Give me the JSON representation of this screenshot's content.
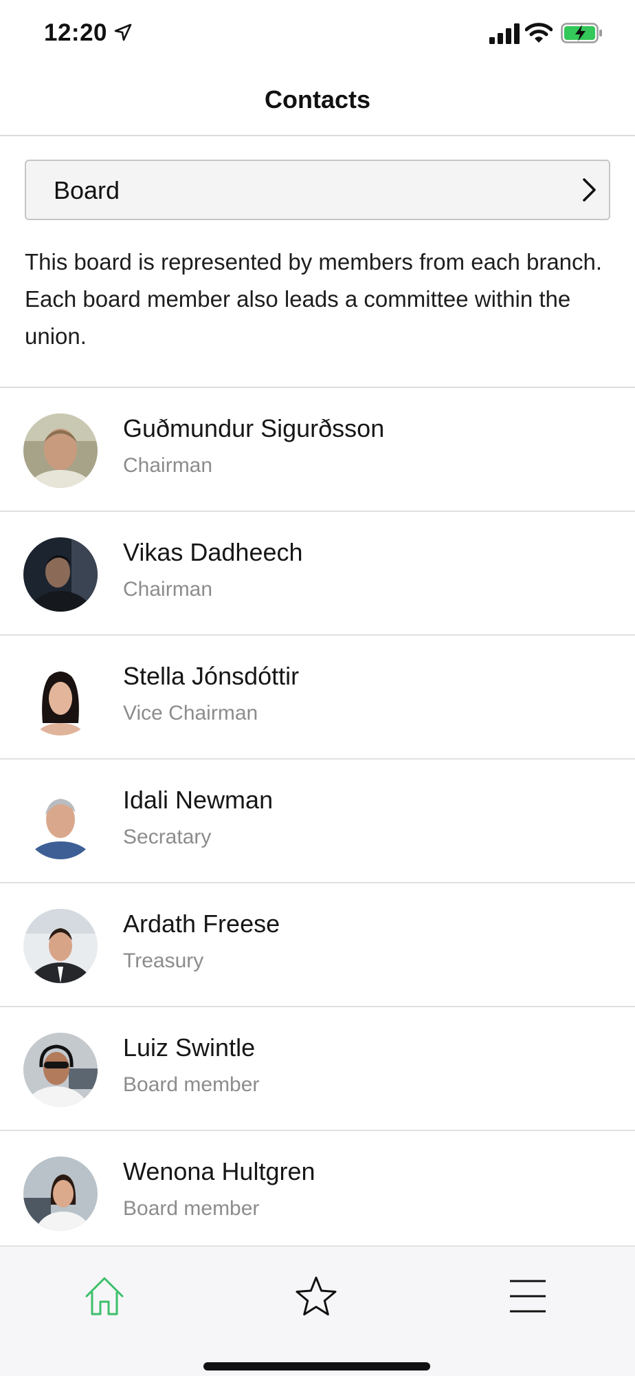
{
  "status_bar": {
    "time": "12:20",
    "icons": [
      "location-arrow-icon",
      "cellular-signal-icon",
      "wifi-icon",
      "battery-charging-icon"
    ]
  },
  "nav": {
    "title": "Contacts"
  },
  "selector": {
    "label": "Board",
    "icon": "chevron-right-icon"
  },
  "description": "This board is represented by members from each branch. Each board member also leads a committee within the union.",
  "contacts": [
    {
      "name": "Guðmundur Sigurðsson",
      "role": "Chairman"
    },
    {
      "name": "Vikas Dadheech",
      "role": "Chairman"
    },
    {
      "name": "Stella Jónsdóttir",
      "role": "Vice Chairman"
    },
    {
      "name": "Idali Newman",
      "role": "Secratary"
    },
    {
      "name": "Ardath Freese",
      "role": "Treasury"
    },
    {
      "name": "Luiz Swintle",
      "role": "Board member"
    },
    {
      "name": "Wenona Hultgren",
      "role": "Board member"
    }
  ],
  "tab_bar": {
    "tabs": [
      {
        "icon": "home-icon",
        "active": true
      },
      {
        "icon": "star-icon",
        "active": false
      },
      {
        "icon": "menu-icon",
        "active": false
      }
    ]
  },
  "colors": {
    "accent_green": "#3dbf6a",
    "battery_green": "#34c759",
    "secondary_text": "#8c8c8c",
    "tab_bar_bg": "#f6f6f8"
  }
}
